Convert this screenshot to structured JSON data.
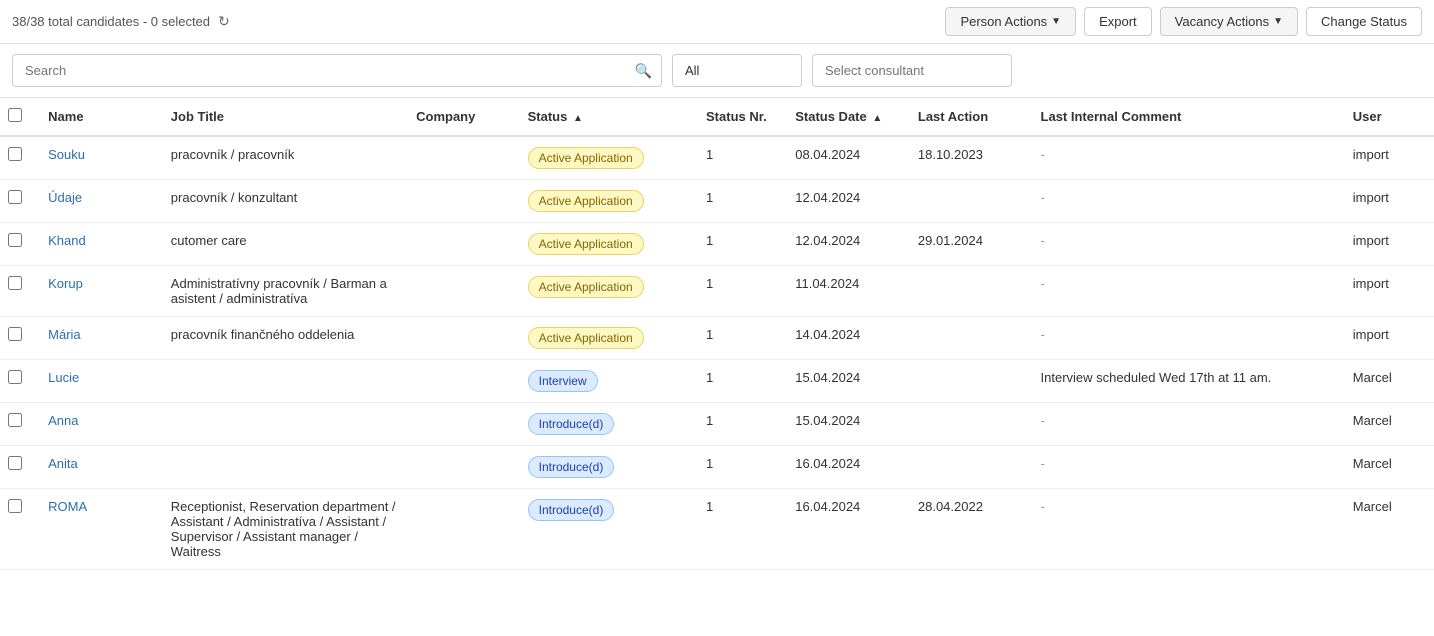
{
  "topbar": {
    "summary": "38/38 total candidates - 0 selected",
    "person_actions_label": "Person Actions",
    "export_label": "Export",
    "vacancy_actions_label": "Vacancy Actions",
    "change_status_label": "Change Status"
  },
  "searchbar": {
    "search_placeholder": "Search",
    "filter_all_value": "All",
    "consultant_placeholder": "Select consultant"
  },
  "table": {
    "headers": [
      {
        "key": "checkbox",
        "label": ""
      },
      {
        "key": "name",
        "label": "Name"
      },
      {
        "key": "jobtitle",
        "label": "Job Title"
      },
      {
        "key": "company",
        "label": "Company"
      },
      {
        "key": "status",
        "label": "Status"
      },
      {
        "key": "statusnr",
        "label": "Status Nr."
      },
      {
        "key": "statusdate",
        "label": "Status Date"
      },
      {
        "key": "lastaction",
        "label": "Last Action"
      },
      {
        "key": "comment",
        "label": "Last Internal Comment"
      },
      {
        "key": "user",
        "label": "User"
      }
    ],
    "rows": [
      {
        "name": "Souku",
        "jobtitle": "pracovník / pracovník",
        "company": "",
        "status": "Active Application",
        "status_type": "active",
        "statusnr": "1",
        "statusdate": "08.04.2024",
        "lastaction": "18.10.2023",
        "comment": "-",
        "user": "import"
      },
      {
        "name": "Údaje",
        "jobtitle": "pracovník / konzultant",
        "company": "",
        "status": "Active Application",
        "status_type": "active",
        "statusnr": "1",
        "statusdate": "12.04.2024",
        "lastaction": "",
        "comment": "-",
        "user": "import"
      },
      {
        "name": "Khand",
        "jobtitle": "cutomer care",
        "company": "",
        "status": "Active Application",
        "status_type": "active",
        "statusnr": "1",
        "statusdate": "12.04.2024",
        "lastaction": "29.01.2024",
        "comment": "-",
        "user": "import"
      },
      {
        "name": "Korup",
        "jobtitle": "Administratívny pracovník / Barman a asistent / administratíva",
        "company": "",
        "status": "Active Application",
        "status_type": "active",
        "statusnr": "1",
        "statusdate": "11.04.2024",
        "lastaction": "",
        "comment": "-",
        "user": "import"
      },
      {
        "name": "Mária",
        "jobtitle": "pracovník finančného oddelenia",
        "company": "",
        "status": "Active Application",
        "status_type": "active",
        "statusnr": "1",
        "statusdate": "14.04.2024",
        "lastaction": "",
        "comment": "-",
        "user": "import"
      },
      {
        "name": "Lucie",
        "jobtitle": "",
        "company": "",
        "status": "Interview",
        "status_type": "interview",
        "statusnr": "1",
        "statusdate": "15.04.2024",
        "lastaction": "",
        "comment": "Interview scheduled Wed 17th at 11 am.",
        "user": "Marcel"
      },
      {
        "name": "Anna",
        "jobtitle": "",
        "company": "",
        "status": "Introduce(d)",
        "status_type": "introduce",
        "statusnr": "1",
        "statusdate": "15.04.2024",
        "lastaction": "",
        "comment": "-",
        "user": "Marcel"
      },
      {
        "name": "Anita",
        "jobtitle": "",
        "company": "",
        "status": "Introduce(d)",
        "status_type": "introduce",
        "statusnr": "1",
        "statusdate": "16.04.2024",
        "lastaction": "",
        "comment": "-",
        "user": "Marcel"
      },
      {
        "name": "ROMA",
        "jobtitle": "Receptionist, Reservation department / Assistant / Administratíva / Assistant / Supervisor / Assistant manager / Waitress",
        "company": "",
        "status": "Introduce(d)",
        "status_type": "introduce",
        "statusnr": "1",
        "statusdate": "16.04.2024",
        "lastaction": "28.04.2022",
        "comment": "-",
        "user": "Marcel"
      }
    ]
  }
}
